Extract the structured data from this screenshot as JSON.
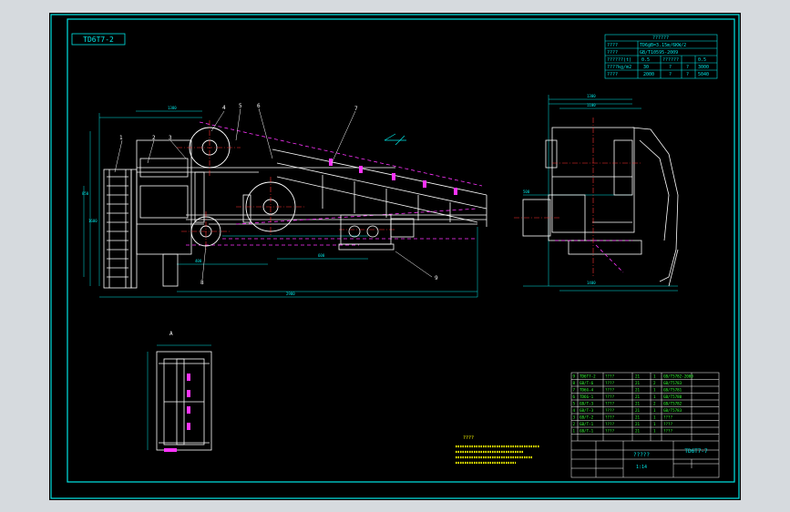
{
  "drawing": {
    "stamp_top": "TD6T7-2",
    "title_block_label": "?????",
    "title_block_scale": "1:14",
    "title_block_code": "TD6T7-7",
    "tech_spec_title": "?????",
    "notes_title": "????",
    "detail_label": "A",
    "part_numbers": [
      "1",
      "2",
      "3",
      "4",
      "5",
      "6",
      "7",
      "8",
      "9"
    ]
  },
  "spec_table": {
    "title": "??????",
    "rows": [
      {
        "label": "????",
        "value": "TD6@B=3.15m/6KW/2"
      },
      {
        "label": "????",
        "value": "GB/T10595-2009"
      },
      {
        "label": "??????(t)",
        "value": "0.5",
        "label2": "??????",
        "value2": "0.5"
      },
      {
        "label": "????kg/m2",
        "value": "30",
        "c2": "?",
        "c3": "?",
        "value2": "3000"
      },
      {
        "label": "????",
        "value": "2000",
        "c2": "?",
        "c3": "?",
        "value2": "5040"
      }
    ]
  },
  "bom_rows": [
    {
      "no": "9",
      "code": "TD6T7-2",
      "name": "????",
      "qty": "21",
      "mat": "1",
      "note": "GB/T5782-2000"
    },
    {
      "no": "8",
      "code": "GB/T-6",
      "name": "????",
      "qty": "21",
      "mat": "2",
      "note": "GB/T5783"
    },
    {
      "no": "7",
      "code": "TD6G-4",
      "name": "????",
      "qty": "21",
      "mat": "1",
      "note": "GB/T5781"
    },
    {
      "no": "6",
      "code": "TD6G-1",
      "name": "????",
      "qty": "21",
      "mat": "1",
      "note": "GB/T5780"
    },
    {
      "no": "5",
      "code": "GB/T-3",
      "name": "????",
      "qty": "21",
      "mat": "2",
      "note": "GB/T5782"
    },
    {
      "no": "4",
      "code": "GB/T-3",
      "name": "????",
      "qty": "21",
      "mat": "1",
      "note": "GB/T5783"
    },
    {
      "no": "3",
      "code": "GB/T-2",
      "name": "????",
      "qty": "21",
      "mat": "1",
      "note": "????"
    },
    {
      "no": "2",
      "code": "GB/T-1",
      "name": "????",
      "qty": "21",
      "mat": "1",
      "note": "????"
    },
    {
      "no": "1",
      "code": "GB/T-1",
      "name": "????",
      "qty": "21",
      "mat": "1",
      "note": "????"
    }
  ],
  "colors": {
    "frame": "#00e5e5",
    "lines": "#ffffff",
    "hidden": "#ff33ff",
    "centerline": "#ff3333",
    "dimension": "#00e5e5",
    "notes": "#ffff00",
    "text_green": "#33ff33"
  }
}
